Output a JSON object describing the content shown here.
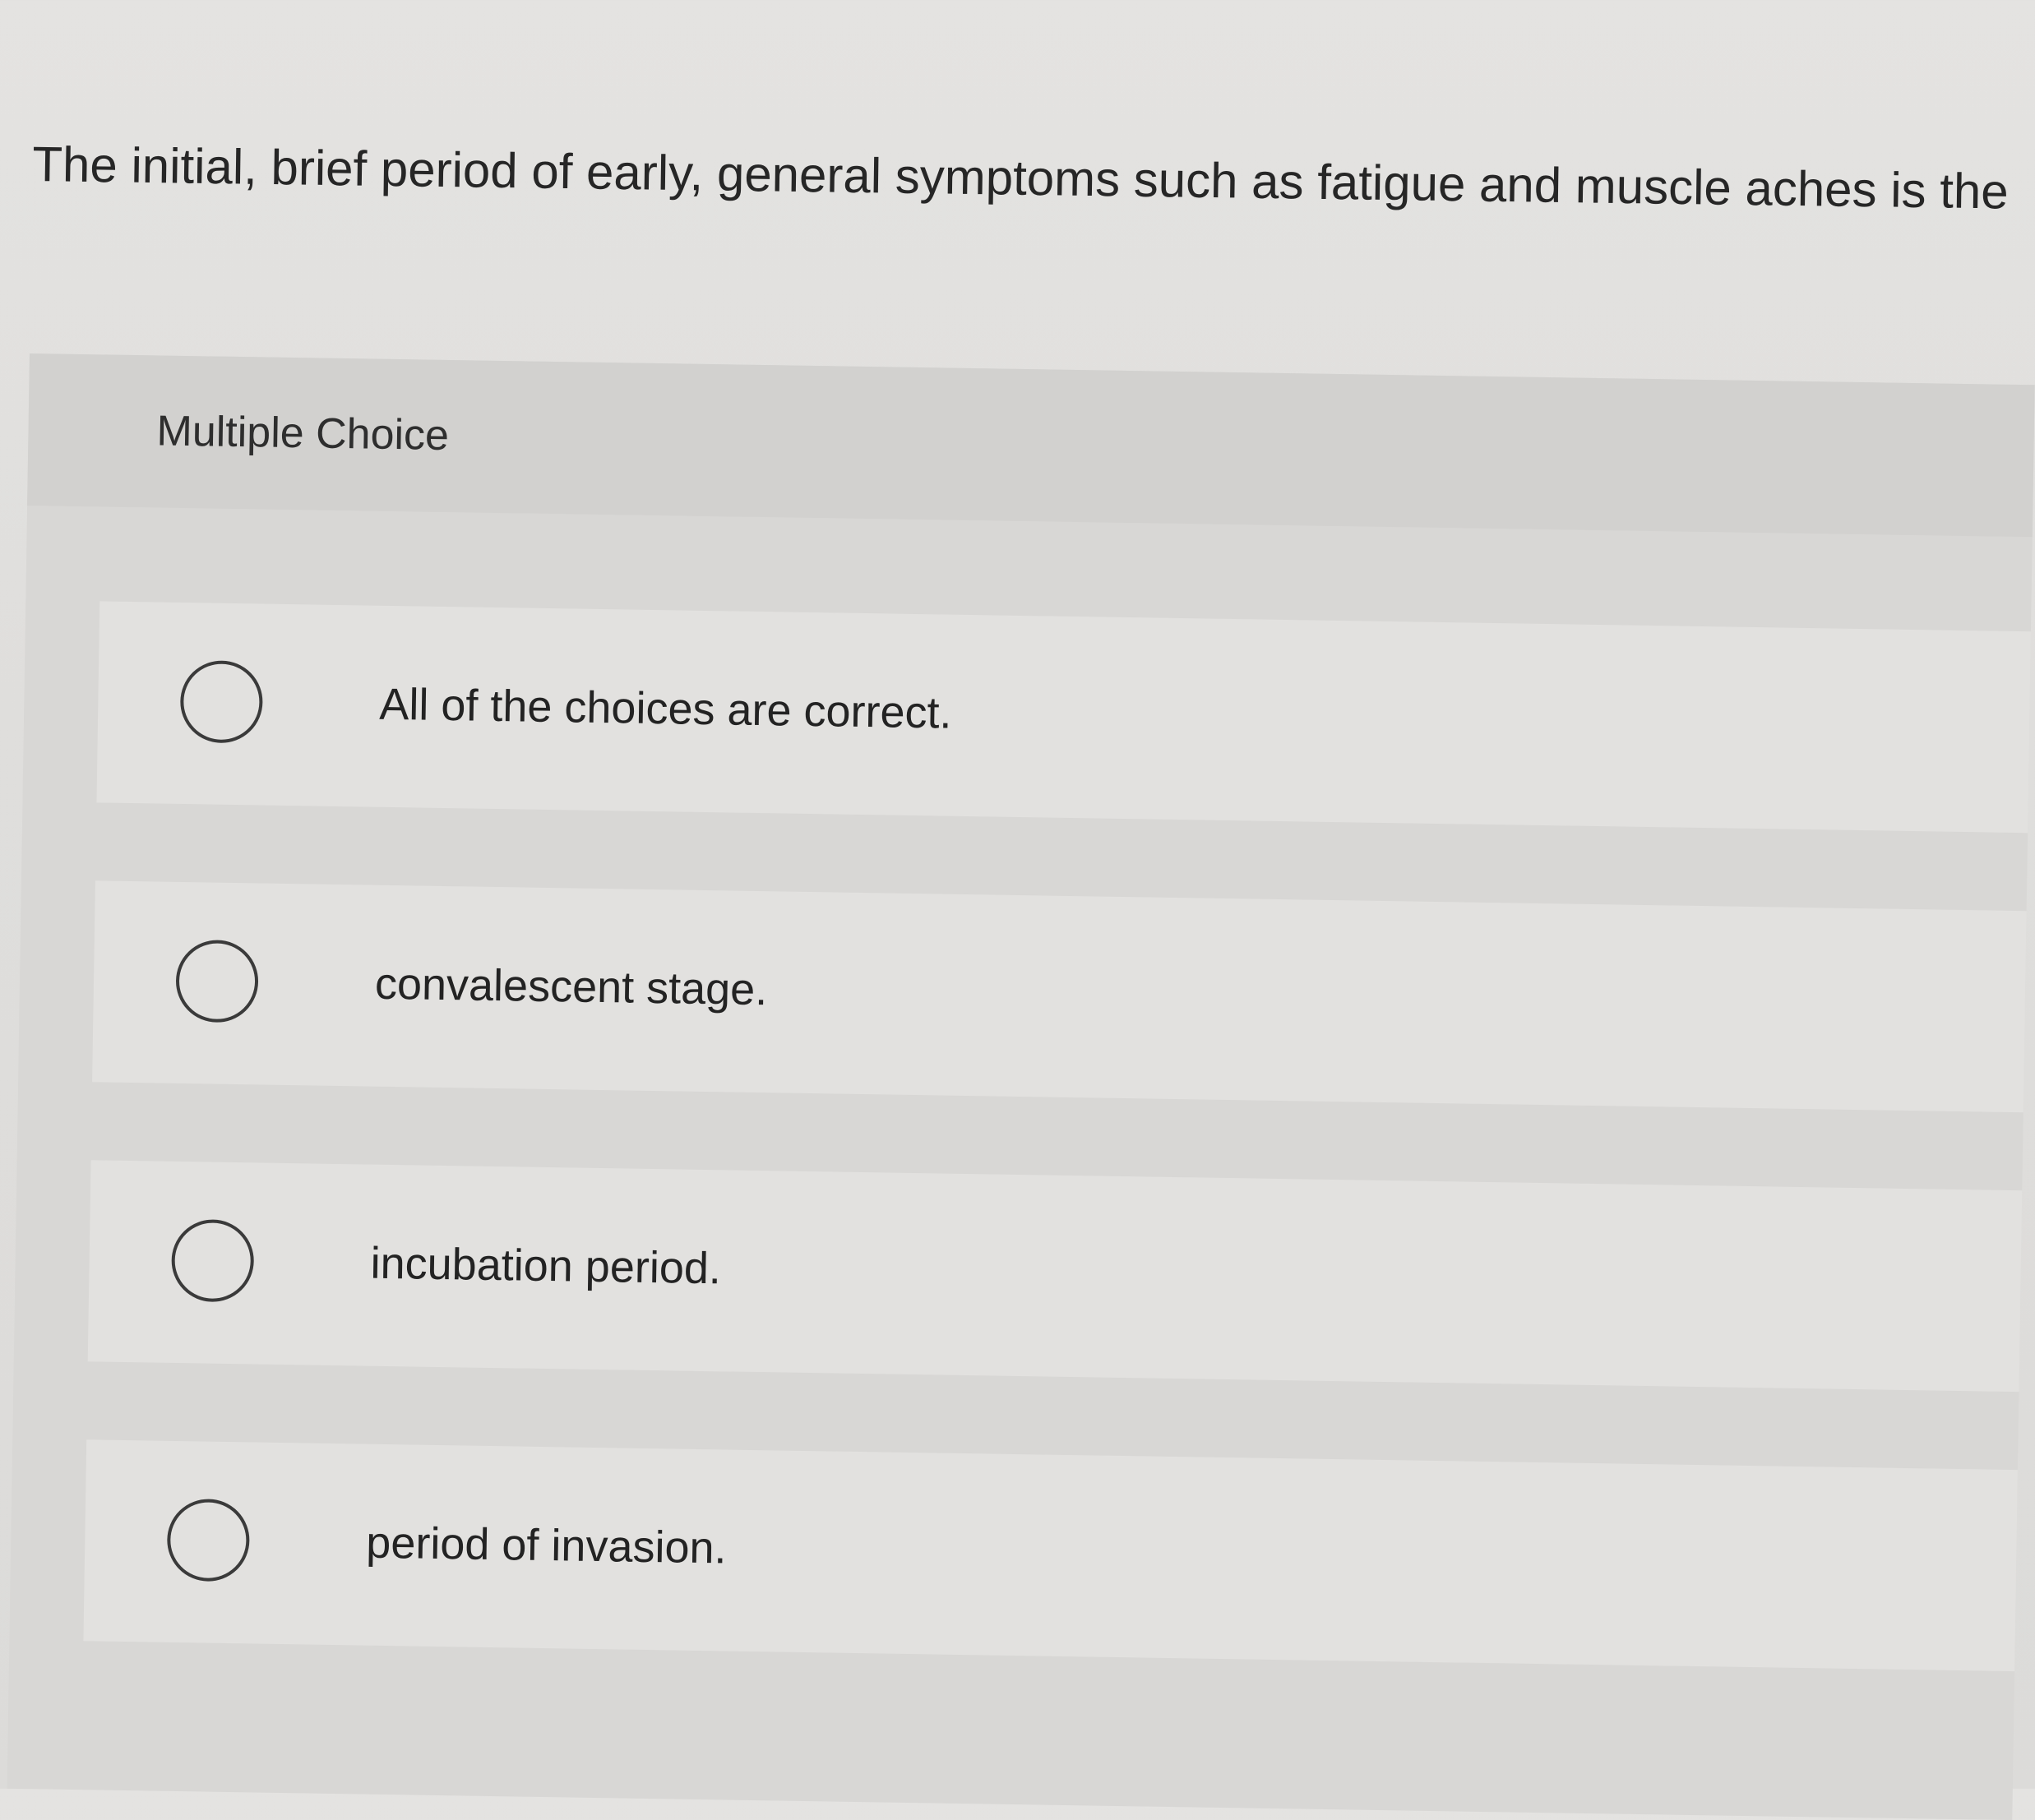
{
  "question": {
    "text": "The initial, brief period of early, general symptoms such as fatigue and muscle aches is the"
  },
  "multiple_choice": {
    "label": "Multiple Choice",
    "options": [
      {
        "label": "All of the choices are correct.",
        "selected": false
      },
      {
        "label": "convalescent stage.",
        "selected": false
      },
      {
        "label": "incubation period.",
        "selected": false
      },
      {
        "label": "period of invasion.",
        "selected": false
      }
    ]
  },
  "colors": {
    "page_background": "#e0dfdd",
    "header_band": "#d2d1cf",
    "option_background": "#e2e1df",
    "text": "#262626",
    "radio_border": "#3a3a3a"
  }
}
